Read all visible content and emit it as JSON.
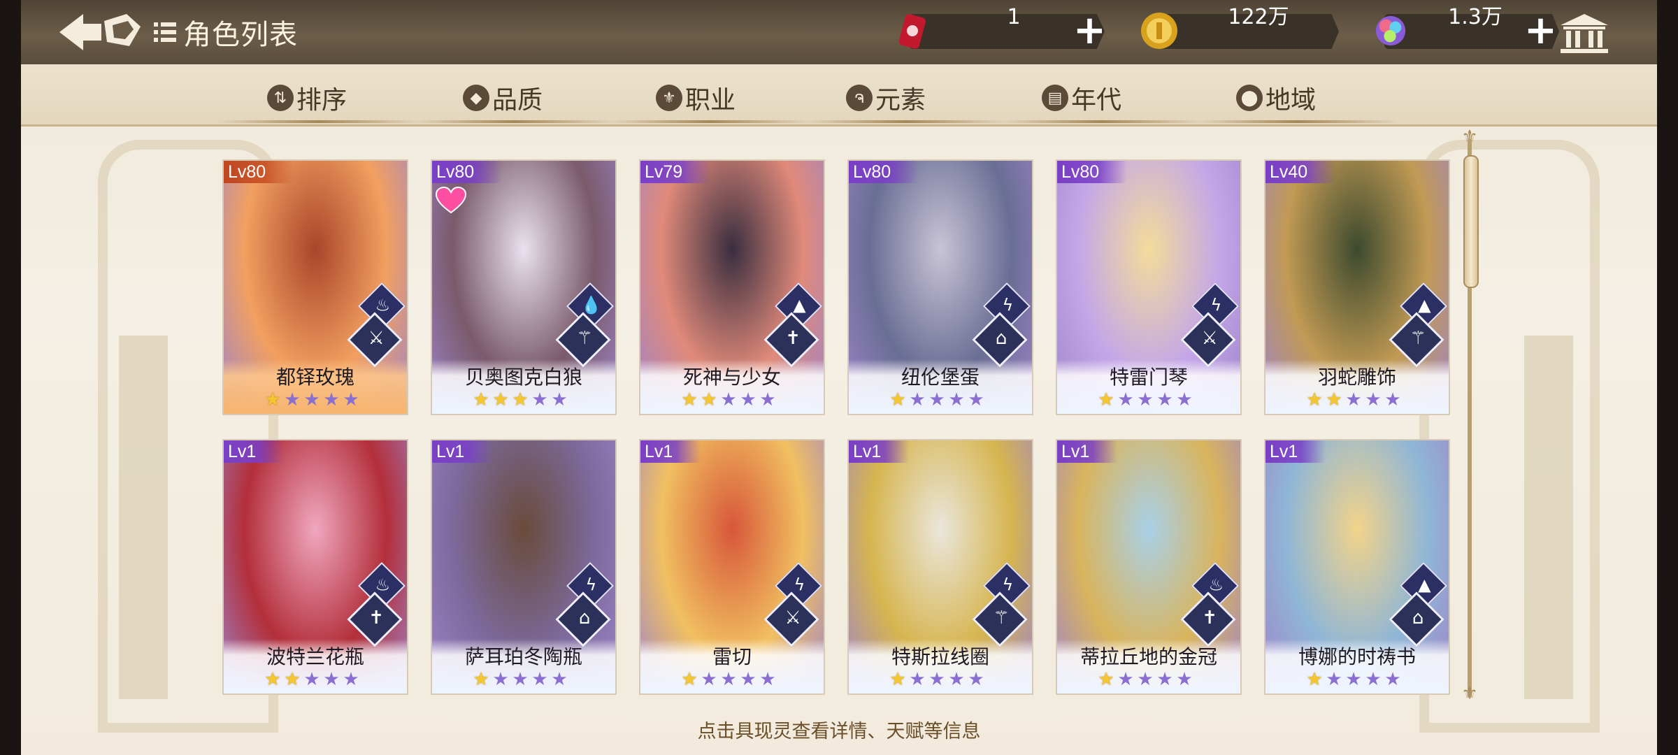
{
  "header": {
    "title": "角色列表",
    "resources": [
      {
        "icon": "ticket-can-icon",
        "value": "1"
      },
      {
        "icon": "gold-coin-icon",
        "value": "122万"
      },
      {
        "icon": "rainbow-gem-icon",
        "value": "1.3万"
      }
    ]
  },
  "filters": [
    "排序",
    "品质",
    "职业",
    "元素",
    "年代",
    "地域"
  ],
  "cards": [
    {
      "level": "Lv80",
      "name": "都铎玫瑰",
      "stars": 1,
      "element": "fire",
      "frame": "gold",
      "colors": [
        "#a8452b",
        "#f2a060"
      ]
    },
    {
      "level": "Lv80",
      "name": "贝奥图克白狼",
      "stars": 3,
      "element": "water",
      "frame": "purple",
      "favorite": true,
      "colors": [
        "#e9e2ee",
        "#7a5a6b"
      ]
    },
    {
      "level": "Lv79",
      "name": "死神与少女",
      "stars": 2,
      "element": "earth",
      "frame": "purple",
      "colors": [
        "#3a2e3f",
        "#e08a7a"
      ]
    },
    {
      "level": "Lv80",
      "name": "纽伦堡蛋",
      "stars": 1,
      "element": "lightning",
      "frame": "purple",
      "colors": [
        "#c9c3d6",
        "#6a6e94"
      ]
    },
    {
      "level": "Lv80",
      "name": "特雷门琴",
      "stars": 1,
      "element": "lightning",
      "frame": "purple",
      "colors": [
        "#f3dc9a",
        "#c4a6e8"
      ]
    },
    {
      "level": "Lv40",
      "name": "羽蛇雕饰",
      "stars": 2,
      "element": "earth",
      "frame": "purple",
      "colors": [
        "#3d4a2e",
        "#c19a54"
      ]
    },
    {
      "level": "Lv1",
      "name": "波特兰花瓶",
      "stars": 2,
      "element": "fire",
      "frame": "purple",
      "colors": [
        "#f0a7c0",
        "#b32f3a"
      ]
    },
    {
      "level": "Lv1",
      "name": "萨耳珀冬陶瓶",
      "stars": 1,
      "element": "lightning",
      "frame": "purple",
      "colors": [
        "#6a4b3b",
        "#7c6a9c"
      ]
    },
    {
      "level": "Lv1",
      "name": "雷切",
      "stars": 1,
      "element": "lightning",
      "frame": "purple",
      "colors": [
        "#d7573a",
        "#f1c061"
      ]
    },
    {
      "level": "Lv1",
      "name": "特斯拉线圈",
      "stars": 1,
      "element": "lightning",
      "frame": "purple",
      "colors": [
        "#eae6dc",
        "#d6b54f"
      ]
    },
    {
      "level": "Lv1",
      "name": "蒂拉丘地的金冠",
      "stars": 1,
      "element": "fire",
      "frame": "purple",
      "colors": [
        "#a9d0e8",
        "#d9b45c"
      ]
    },
    {
      "level": "Lv1",
      "name": "博娜的时祷书",
      "stars": 1,
      "element": "earth",
      "frame": "purple",
      "colors": [
        "#f2d38a",
        "#8fb6d6"
      ]
    }
  ],
  "hint": "点击具现灵查看详情、天赋等信息"
}
